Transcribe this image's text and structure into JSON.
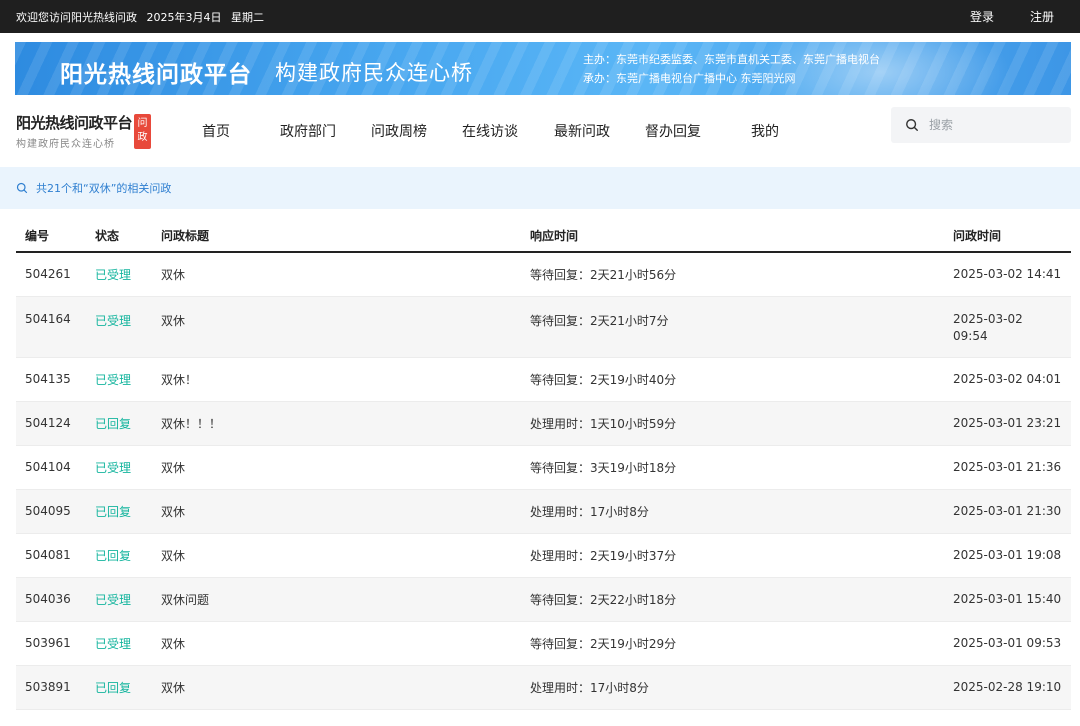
{
  "topbar": {
    "welcome": "欢迎您访问阳光热线问政",
    "date": "2025年3月4日",
    "weekday": "星期二",
    "login": "登录",
    "register": "注册"
  },
  "banner": {
    "title": "阳光热线问政平台",
    "subtitle": "构建政府民众连心桥",
    "host": "主办：东莞市纪委监委、东莞市直机关工委、东莞广播电视台",
    "organizer": "承办：东莞广播电视台广播中心 东莞阳光网"
  },
  "logo": {
    "main": "阳光热线问政平台",
    "sub": "构建政府民众连心桥",
    "badge_top": "问",
    "badge_bottom": "政"
  },
  "nav": {
    "items": [
      {
        "label": "首页"
      },
      {
        "label": "政府部门"
      },
      {
        "label": "问政周榜"
      },
      {
        "label": "在线访谈"
      },
      {
        "label": "最新问政"
      },
      {
        "label": "督办回复"
      },
      {
        "label": "我的"
      }
    ]
  },
  "search": {
    "placeholder": "搜索",
    "icon": "search-icon"
  },
  "results": {
    "summary": "共21个和“双休”的相关问政",
    "icon": "search-icon"
  },
  "table": {
    "headers": {
      "id": "编号",
      "status": "状态",
      "title": "问政标题",
      "response": "响应时间",
      "time": "问政时间"
    },
    "rows": [
      {
        "id": "504261",
        "status": "已受理",
        "title": "双休",
        "response": "等待回复：2天21小时56分",
        "time": "2025-03-02 14:41"
      },
      {
        "id": "504164",
        "status": "已受理",
        "title": "双休",
        "response": "等待回复：2天21小时7分",
        "time_date": "2025-03-02",
        "time_clock": "09:54"
      },
      {
        "id": "504135",
        "status": "已受理",
        "title": "双休！",
        "response": "等待回复：2天19小时40分",
        "time": "2025-03-02 04:01"
      },
      {
        "id": "504124",
        "status": "已回复",
        "title": "双休！！！",
        "response": "处理用时：1天10小时59分",
        "time": "2025-03-01 23:21"
      },
      {
        "id": "504104",
        "status": "已受理",
        "title": "双休",
        "response": "等待回复：3天19小时18分",
        "time": "2025-03-01 21:36"
      },
      {
        "id": "504095",
        "status": "已回复",
        "title": "双休",
        "response": "处理用时：17小时8分",
        "time": "2025-03-01 21:30"
      },
      {
        "id": "504081",
        "status": "已回复",
        "title": "双休",
        "response": "处理用时：2天19小时37分",
        "time": "2025-03-01 19:08"
      },
      {
        "id": "504036",
        "status": "已受理",
        "title": "双休问题",
        "response": "等待回复：2天22小时18分",
        "time": "2025-03-01 15:40"
      },
      {
        "id": "503961",
        "status": "已受理",
        "title": "双休",
        "response": "等待回复：2天19小时29分",
        "time": "2025-03-01 09:53"
      },
      {
        "id": "503891",
        "status": "已回复",
        "title": "双休",
        "response": "处理用时：17小时8分",
        "time": "2025-02-28 19:10"
      }
    ]
  },
  "colors": {
    "topbar_bg": "#1f1f1f",
    "status_green": "#15b59e",
    "badge_red": "#e8493b",
    "result_bg": "#eaf4fd",
    "result_text": "#2f7fd0"
  }
}
